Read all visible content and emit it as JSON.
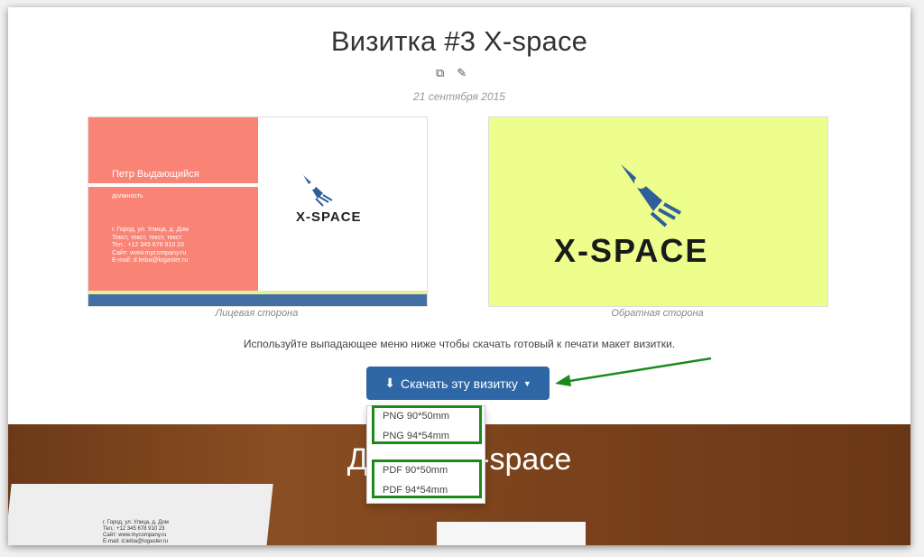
{
  "page": {
    "title": "Визитка #3 X-space",
    "date": "21 сентября 2015",
    "icons": [
      "copy-icon",
      "pencil-icon"
    ],
    "front_caption": "Лицевая сторона",
    "back_caption": "Обратная сторона",
    "info_text": "Используйте выпадающее меню ниже чтобы скачать готовый к печати макет визитки."
  },
  "card_front": {
    "name": "Петр Выдающийся",
    "position": "должность",
    "details": [
      "г. Город, ул. Улица, д. Дом",
      "Текст, текст, текст, текст",
      "Тел.: +12 345 678 910 23",
      "Сайт: www.mycompany.ru",
      "E-mail: d.leiba@logaster.ru"
    ],
    "brand": "X-SPACE",
    "colors": {
      "left": "#f98374",
      "stripe": "#436fa3"
    }
  },
  "card_back": {
    "brand": "X-SPACE",
    "background": "#eefe8d"
  },
  "download": {
    "button_label": "Скачать эту визитку",
    "options": [
      "PNG 90*50mm",
      "PNG 94*54mm",
      "PDF 90*50mm",
      "PDF 94*54mm"
    ]
  },
  "wood": {
    "title": "Дизайн X-space",
    "paper_lines": [
      "г. Город, ул. Улица, д. Дом",
      "Тел.: +12 345 678 910 23",
      "Сайт: www.mycompany.ru",
      "E-mail: d.leiba@logaster.ru"
    ]
  },
  "accent_color": "#2f67a6",
  "highlight_color": "#1a8a1a"
}
